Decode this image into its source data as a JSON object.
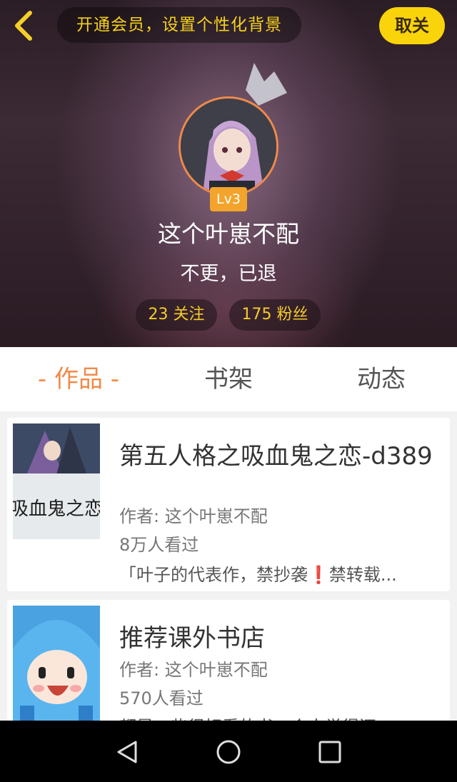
{
  "header": {
    "vip_promo": "开通会员，设置个性化背景",
    "follow_button": "取关",
    "level": "Lv3",
    "username": "这个叶崽不配",
    "bio": "不更，已退",
    "stats": {
      "following": "23 关注",
      "fans": "175 粉丝"
    }
  },
  "tabs": {
    "works": "作品",
    "shelf": "书架",
    "feed": "动态"
  },
  "books": [
    {
      "title": "第五人格之吸血鬼之恋-d389",
      "author": "作者: 这个叶崽不配",
      "views": "8万人看过",
      "desc_before": "「叶子的代表作，禁抄袭",
      "desc_mark": "❗",
      "desc_after": "禁转载...",
      "cover_text": "吸血鬼之恋"
    },
    {
      "title": "推荐课外书店",
      "author": "作者: 这个叶崽不配",
      "views": "570人看过",
      "desc": "都是一些很好看的书，个人觉得还..."
    }
  ],
  "colors": {
    "accent": "#f08a4b",
    "gold": "#f9d40a",
    "promo_text": "#f7d21c"
  },
  "icons": [
    "back-arrow-icon",
    "crown-icon",
    "nav-back-icon",
    "nav-home-icon",
    "nav-recents-icon"
  ]
}
